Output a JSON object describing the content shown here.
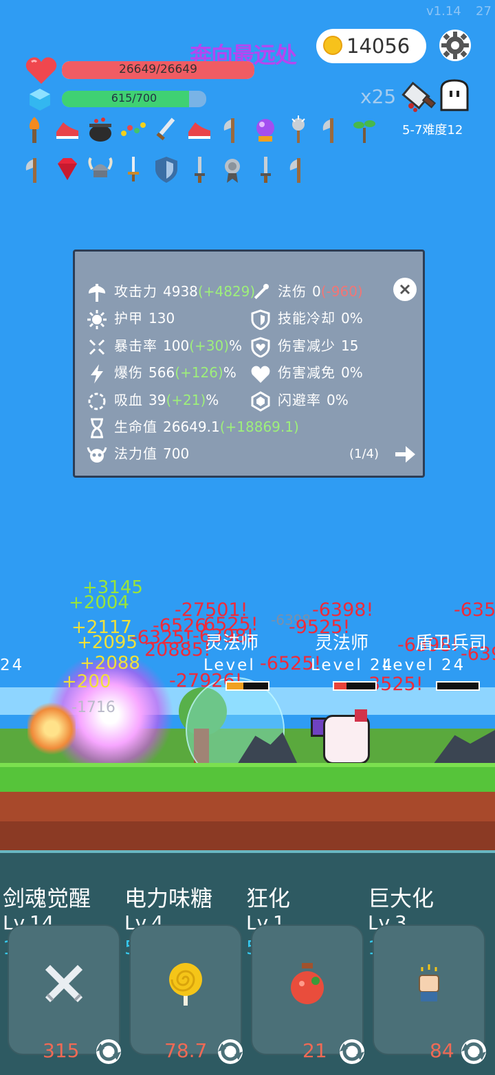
{
  "header": {
    "version": "v1.14",
    "version_extra": "27",
    "title": "奔向最远处",
    "coins": "14056"
  },
  "player": {
    "hp_text": "26649/26649",
    "hp_fraction": 1.0,
    "mp_text": "615/700",
    "mp_fraction": 0.88
  },
  "stage": {
    "multiplier": "x25",
    "stage_text": "5-7难度12"
  },
  "items_row1": [
    "torch-icon",
    "sneaker-icon",
    "cauldron-icon",
    "beads-icon",
    "sword-icon",
    "sneaker-icon",
    "axe-icon",
    "crystal-ball-icon",
    "mace-icon",
    "axe-icon",
    "sapling-icon"
  ],
  "items_row2": [
    "axe-icon",
    "ruby-icon",
    "viking-helmet-icon",
    "dagger-icon",
    "shield-icon",
    "short-sword-icon",
    "medal-icon",
    "short-sword-icon",
    "axe-icon"
  ],
  "stats": {
    "attack_label": "攻击力",
    "attack_value": "4938",
    "attack_bonus": "(+4829)",
    "magic_label": "法伤",
    "magic_value": "0",
    "magic_bonus": "(-960)",
    "armor_label": "护甲",
    "armor_value": "130",
    "cooldown_label": "技能冷却",
    "cooldown_value": "0%",
    "crit_label": "暴击率",
    "crit_value": "100",
    "crit_bonus": "(+30)",
    "crit_unit": "%",
    "dmg_reduce_label": "伤害减少",
    "dmg_reduce_value": "15",
    "crit_dmg_label": "爆伤",
    "crit_dmg_value": "566",
    "crit_dmg_bonus": "(+126)",
    "crit_dmg_unit": "%",
    "dmg_immune_label": "伤害减免",
    "dmg_immune_value": "0%",
    "lifesteal_label": "吸血",
    "lifesteal_value": "39",
    "lifesteal_bonus": "(+21)",
    "lifesteal_unit": "%",
    "dodge_label": "闪避率",
    "dodge_value": "0%",
    "hp_label": "生命值",
    "hp_value": "26649.1",
    "hp_bonus": "(+18869.1)",
    "mana_label": "法力值",
    "mana_value": "700",
    "page": "(1/4)"
  },
  "battle": {
    "damage_numbers": [
      "-27501!",
      "-6526",
      "6525!",
      "-6398!",
      "-6398",
      "-9525!",
      "-6398!",
      "-635",
      "-6325!",
      "20885!",
      "-6525!",
      "-27926!",
      "-6398!",
      "-639",
      "3525!",
      "-1716"
    ],
    "heal_numbers": [
      "+3145",
      "+2004",
      "+2117",
      "+2095",
      "+2088",
      "+200"
    ],
    "enemy_names": [
      "灵法师",
      "灵法师",
      "盾卫兵司"
    ],
    "enemy_levels": [
      "Level",
      "Level 24",
      "Level 24",
      "24"
    ]
  },
  "skills": [
    {
      "name": "剑魂觉醒",
      "level": "Lv.14",
      "cost": "10",
      "value": "315",
      "icon": "crossed-swords-icon"
    },
    {
      "name": "电力味糖",
      "level": "Lv.4",
      "cost": "5",
      "value": "78.7",
      "icon": "lollipop-icon"
    },
    {
      "name": "狂化",
      "level": "Lv.1",
      "cost": "5",
      "value": "21",
      "icon": "potion-icon"
    },
    {
      "name": "巨大化",
      "level": "Lv.3",
      "cost": "15",
      "value": "84",
      "icon": "fist-icon"
    }
  ]
}
